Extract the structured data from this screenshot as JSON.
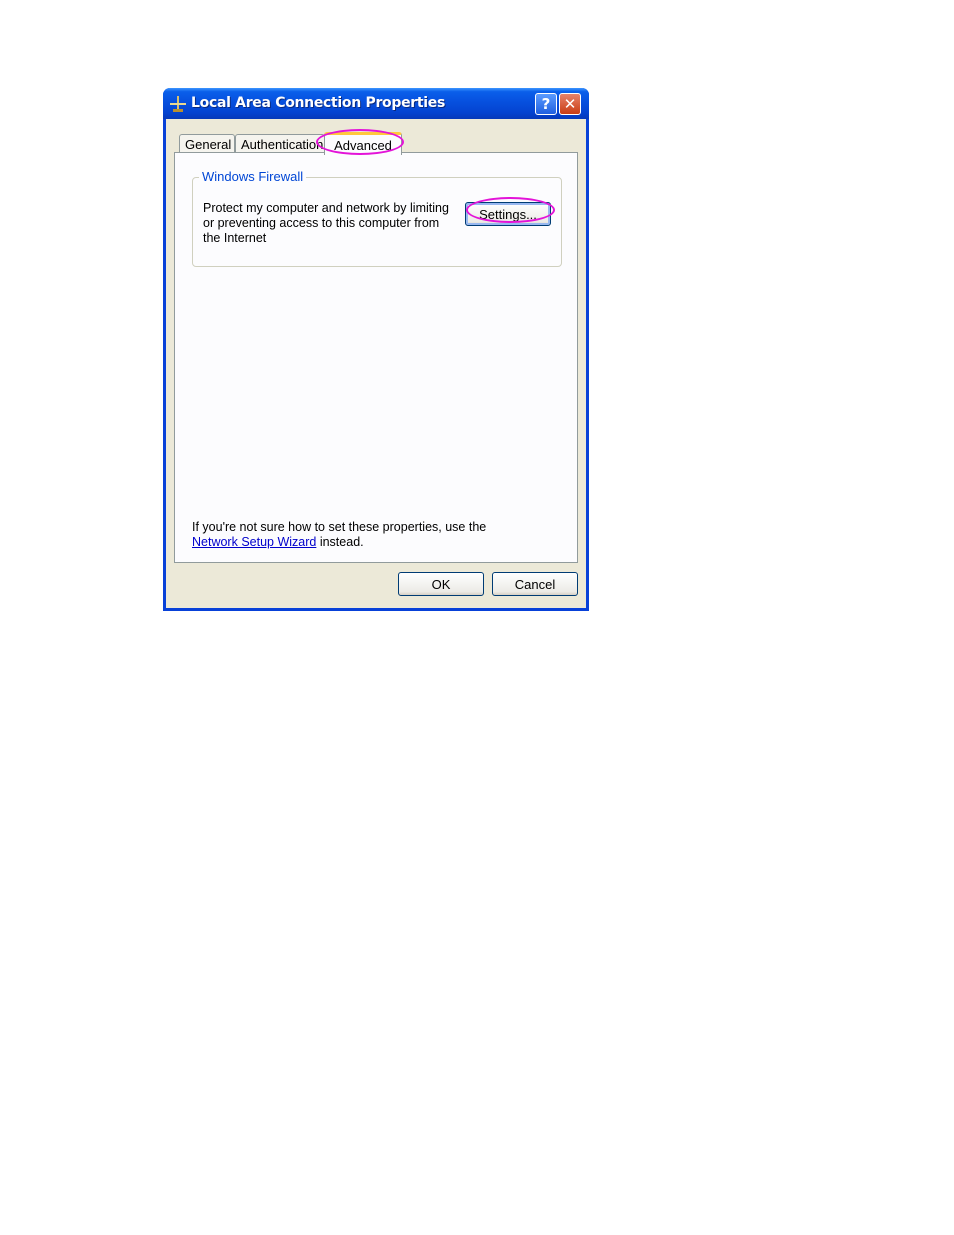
{
  "window": {
    "title": "Local Area Connection Properties",
    "help_label": "?",
    "close_label": "✕"
  },
  "tabs": [
    {
      "label": "General",
      "active": false
    },
    {
      "label": "Authentication",
      "active": false
    },
    {
      "label": "Advanced",
      "active": true
    }
  ],
  "firewall": {
    "group_label": "Windows Firewall",
    "description": "Protect my computer and network by limiting or preventing access to this computer from the Internet",
    "settings_button": "Settings..."
  },
  "note": {
    "prefix": "If you're not sure how to set these properties, use the ",
    "link": "Network Setup Wizard",
    "suffix": " instead."
  },
  "buttons": {
    "ok": "OK",
    "cancel": "Cancel"
  },
  "colors": {
    "title_bar": "#0752E0",
    "dialog_bg": "#ECE9D8",
    "highlight": "#E313D8",
    "group_label": "#0046D5"
  }
}
